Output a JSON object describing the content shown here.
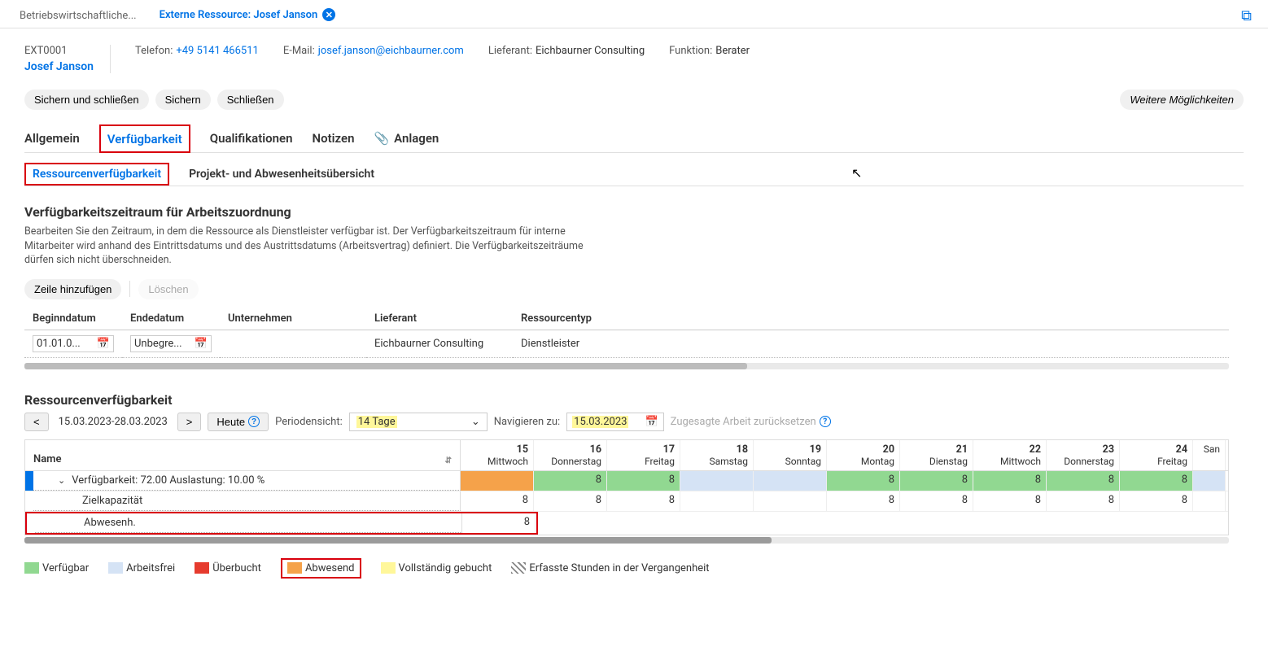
{
  "topTabs": {
    "tab1": "Betriebswirtschaftliche...",
    "tab2": "Externe Ressource: Josef Janson"
  },
  "header": {
    "id": "EXT0001",
    "name": "Josef Janson",
    "phone_label": "Telefon:",
    "phone": "+49 5141 466511",
    "email_label": "E-Mail:",
    "email": "josef.janson@eichbaurner.com",
    "supplier_label": "Lieferant:",
    "supplier": "Eichbaurner Consulting",
    "role_label": "Funktion:",
    "role": "Berater"
  },
  "actions": {
    "save_close": "Sichern und schließen",
    "save": "Sichern",
    "close": "Schließen",
    "more": "Weitere Möglichkeiten"
  },
  "mainTabs": {
    "general": "Allgemein",
    "availability": "Verfügbarkeit",
    "qualifications": "Qualifikationen",
    "notes": "Notizen",
    "attachments": "Anlagen"
  },
  "subTabs": {
    "resource_avail": "Ressourcenverfügbarkeit",
    "project_absence": "Projekt- und Abwesenheitsübersicht"
  },
  "section1": {
    "title": "Verfügbarkeitszeitraum für Arbeitszuordnung",
    "desc": "Bearbeiten Sie den Zeitraum, in dem die Ressource als Dienstleister verfügbar ist. Der Verfügbarkeitszeitraum für interne Mitarbeiter wird anhand des Eintrittsdatums und des Austrittsdatums (Arbeitsvertrag) definiert. Die Verfügbarkeitszeiträume dürfen sich nicht überschneiden.",
    "add_row": "Zeile hinzufügen",
    "delete": "Löschen",
    "cols": {
      "begin": "Beginndatum",
      "end": "Endedatum",
      "company": "Unternehmen",
      "supplier": "Lieferant",
      "type": "Ressourcentyp"
    },
    "row": {
      "begin": "01.01.0...",
      "end": "Unbegre...",
      "company": "",
      "supplier": "Eichbaurner Consulting",
      "type": "Dienstleister"
    }
  },
  "section2": {
    "title": "Ressourcenverfügbarkeit",
    "prev": "<",
    "next": ">",
    "range": "15.03.2023-28.03.2023",
    "today": "Heute",
    "period_label": "Periodensicht:",
    "period_value": "14 Tage",
    "navigate_label": "Navigieren zu:",
    "navigate_value": "15.03.2023",
    "reset": "Zugesagte Arbeit zurücksetzen",
    "name_col": "Name",
    "days": [
      {
        "num": "15",
        "wd": "Mittwoch"
      },
      {
        "num": "16",
        "wd": "Donnerstag"
      },
      {
        "num": "17",
        "wd": "Freitag"
      },
      {
        "num": "18",
        "wd": "Samstag"
      },
      {
        "num": "19",
        "wd": "Sonntag"
      },
      {
        "num": "20",
        "wd": "Montag"
      },
      {
        "num": "21",
        "wd": "Dienstag"
      },
      {
        "num": "22",
        "wd": "Mittwoch"
      },
      {
        "num": "23",
        "wd": "Donnerstag"
      },
      {
        "num": "24",
        "wd": "Freitag"
      }
    ],
    "last_day": "San",
    "availability_row": "Verfügbarkeit: 72.00    Auslastung: 10.00 %",
    "target_row": "Zielkapazität",
    "absence_row": "Abwesenh.",
    "avail_cells": [
      "",
      "8",
      "8",
      "",
      "",
      "8",
      "8",
      "8",
      "8",
      "8"
    ],
    "target_cells": [
      "8",
      "8",
      "8",
      "",
      "",
      "8",
      "8",
      "8",
      "8",
      "8"
    ],
    "absence_cells": [
      "8",
      "",
      "",
      "",
      "",
      "",
      "",
      "",
      "",
      ""
    ]
  },
  "legend": {
    "available": "Verfügbar",
    "nonwork": "Arbeitsfrei",
    "overbooked": "Überbucht",
    "absent": "Abwesend",
    "fullybooked": "Vollständig gebucht",
    "recorded": "Erfasste Stunden in der Vergangenheit"
  }
}
